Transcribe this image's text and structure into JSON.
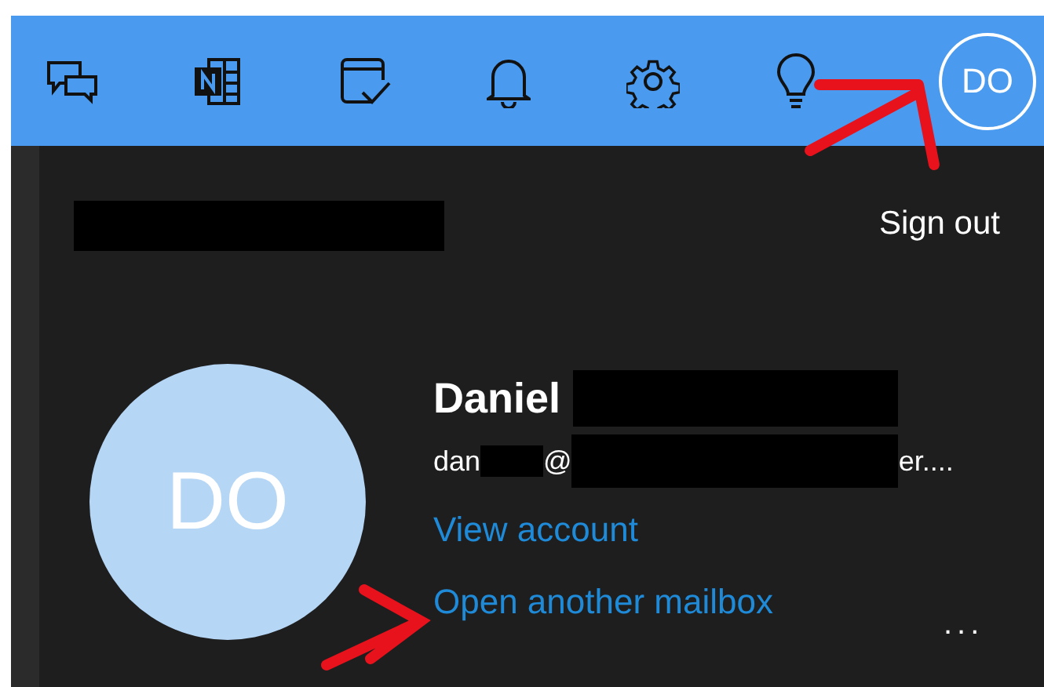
{
  "toolbar": {
    "avatar_initials": "DO"
  },
  "account_panel": {
    "sign_out": "Sign out",
    "avatar_initials": "DO",
    "name": "Daniel",
    "email_parts": [
      "dan",
      "@",
      "er...."
    ],
    "links": [
      "View account",
      "Open another mailbox"
    ],
    "more": "..."
  }
}
